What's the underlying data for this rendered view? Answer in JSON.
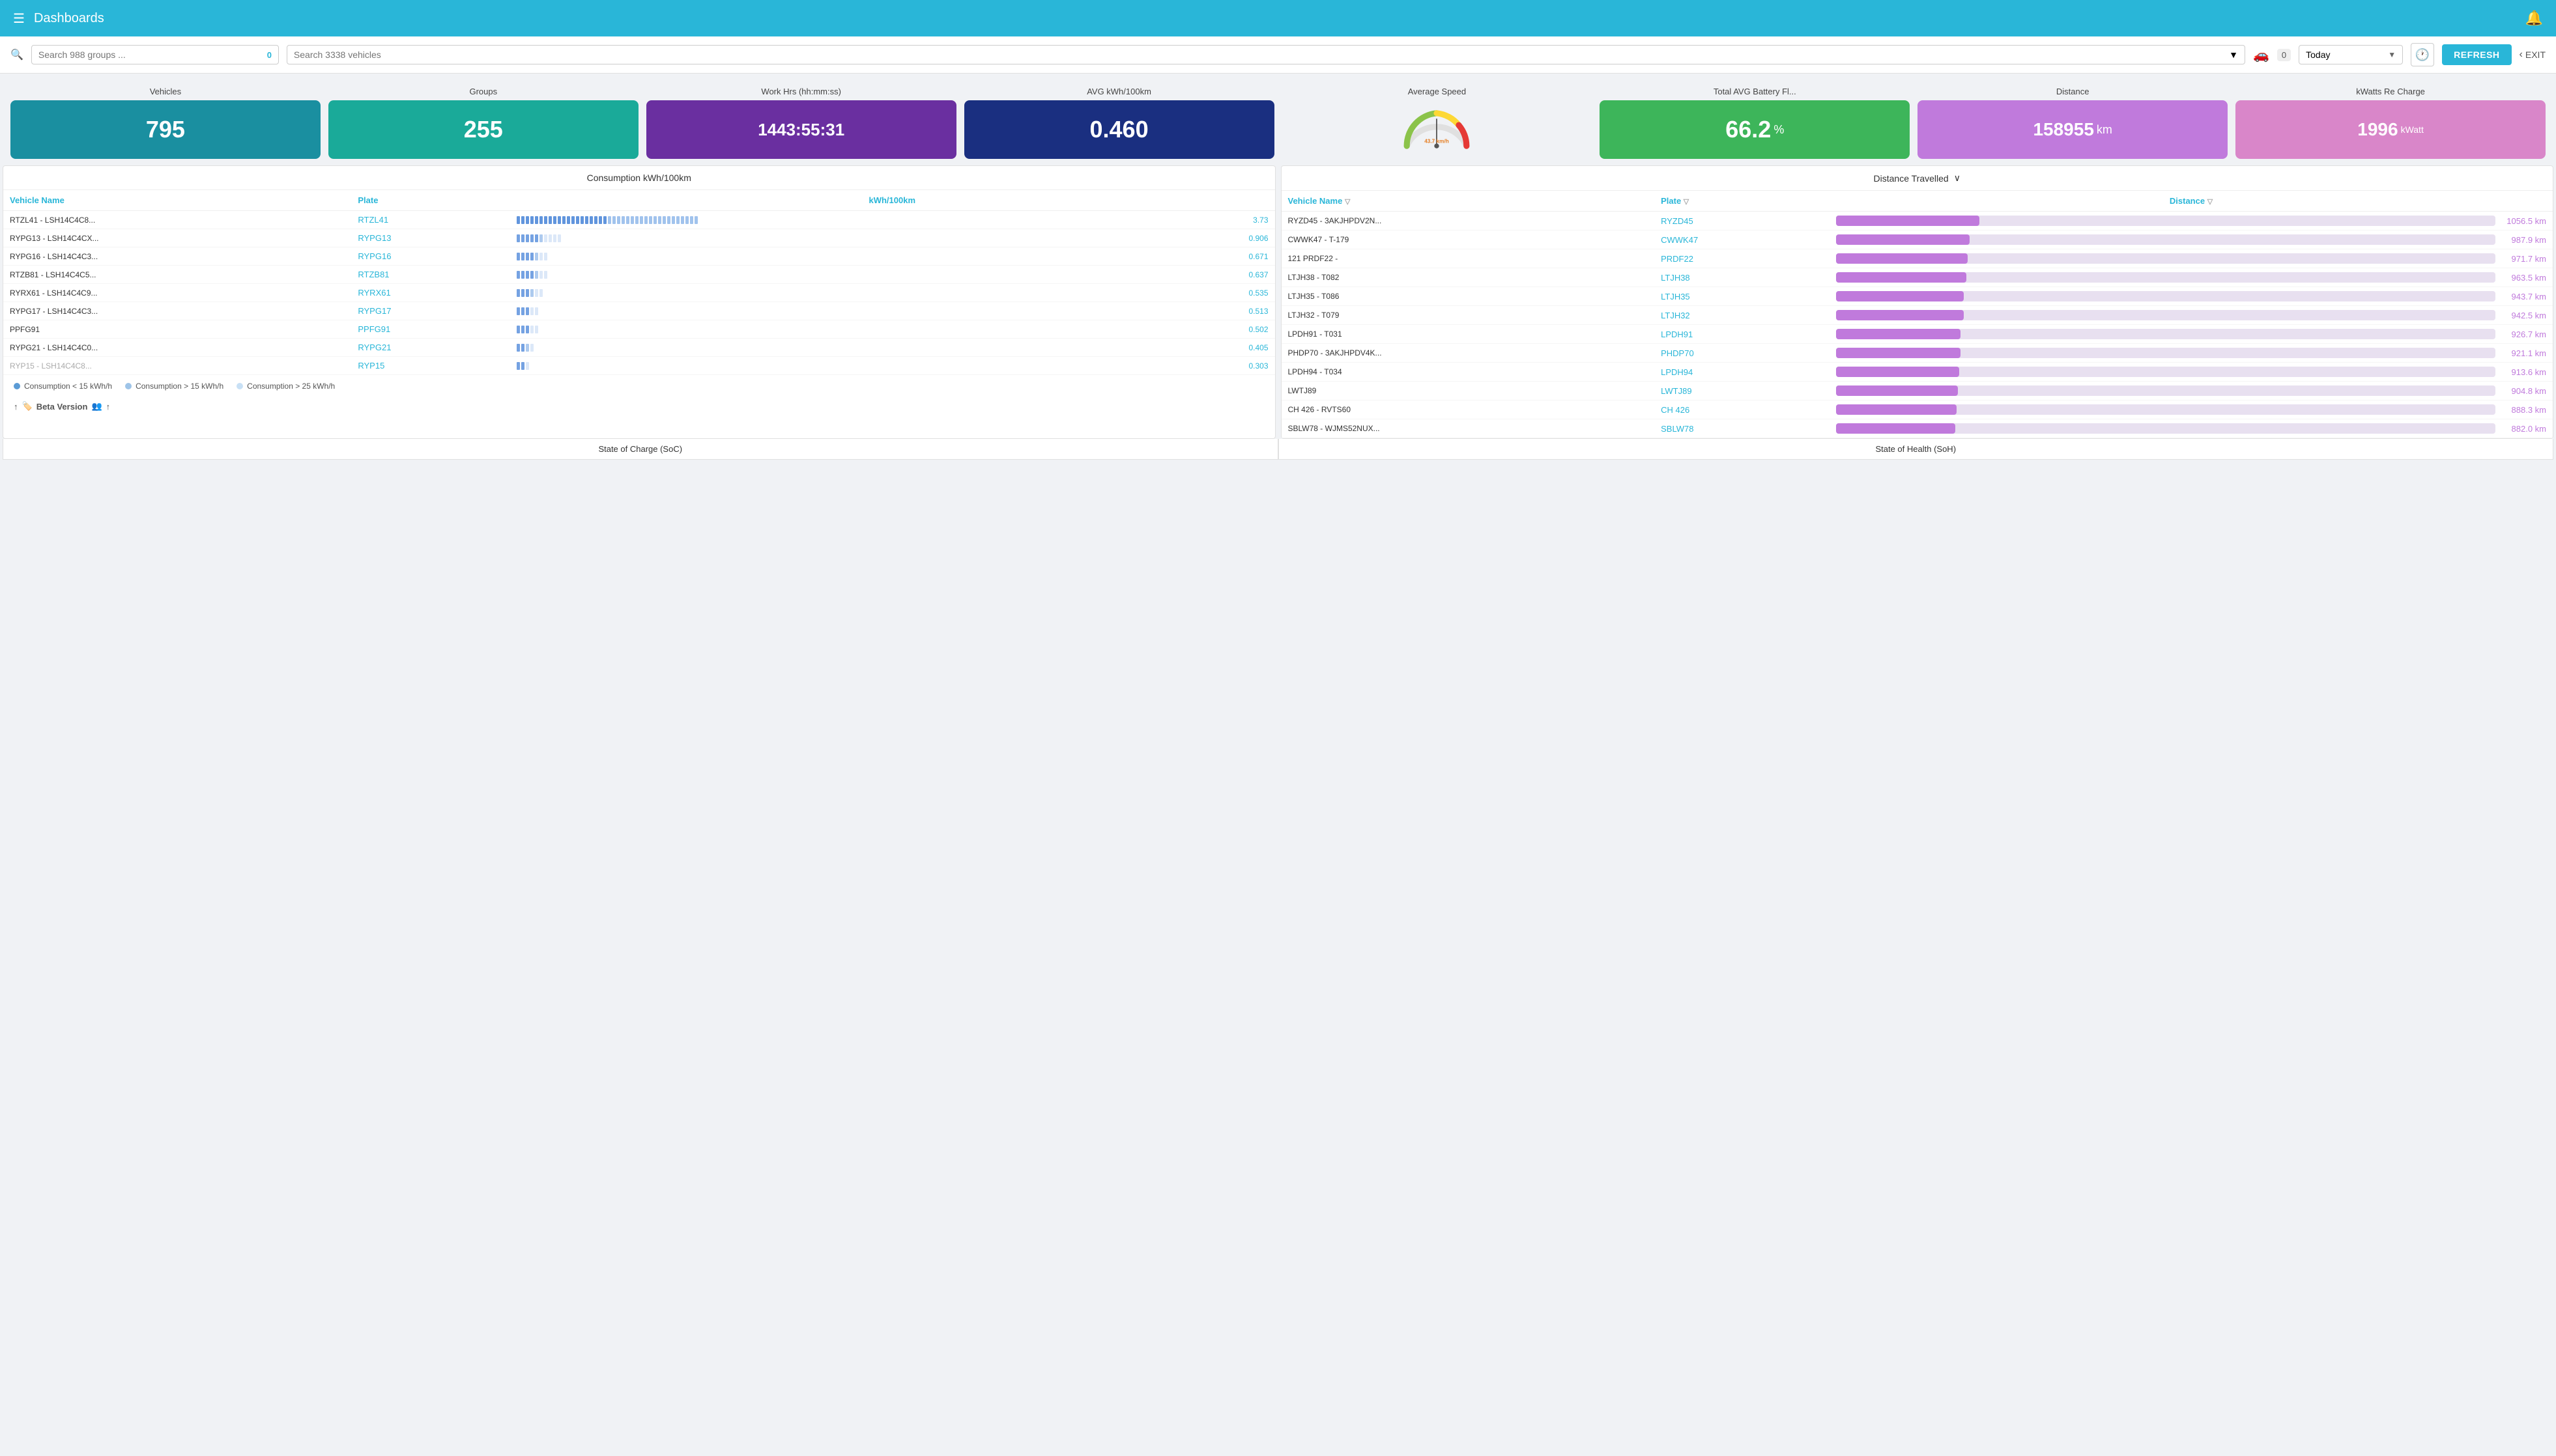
{
  "header": {
    "menu_icon": "☰",
    "title": "Dashboards",
    "bell_icon": "🔔"
  },
  "toolbar": {
    "search_groups_placeholder": "Search 988 groups ...",
    "search_groups_badge": "0",
    "search_vehicles_placeholder": "Search 3338 vehicles",
    "vehicle_icon": "🚗",
    "vehicle_count": "0",
    "date_label": "Today",
    "clock_icon": "🕐",
    "refresh_label": "REFRESH",
    "exit_label": "EXIT"
  },
  "stats": [
    {
      "label": "Vehicles",
      "value": "795",
      "suffix": "",
      "color": "teal"
    },
    {
      "label": "Groups",
      "value": "255",
      "suffix": "",
      "color": "teal2"
    },
    {
      "label": "Work Hrs (hh:mm:ss)",
      "value": "1443:55:31",
      "suffix": "",
      "color": "purple",
      "small": true
    },
    {
      "label": "AVG kWh/100km",
      "value": "0.460",
      "suffix": "",
      "color": "navy"
    },
    {
      "label": "Average Speed",
      "value": "43.7 km/h",
      "color": "gauge"
    },
    {
      "label": "Total AVG Battery Fl...",
      "value": "66.2",
      "suffix": "%",
      "color": "green"
    },
    {
      "label": "Distance",
      "value": "158955",
      "suffix": " km",
      "color": "violet"
    },
    {
      "label": "kWatts Re Charge",
      "value": "1996",
      "suffix": " kWatt",
      "color": "pink"
    }
  ],
  "consumption_table": {
    "title": "Consumption kWh/100km",
    "columns": [
      "Vehicle Name",
      "Plate",
      "kWh/100km"
    ],
    "rows": [
      {
        "name": "RTZL41 - LSH14C4C8...",
        "plate": "RTZL41",
        "value": 3.73,
        "bar_pct": 100
      },
      {
        "name": "RYPG13 - LSH14C4CX...",
        "plate": "RYPG13",
        "value": 0.906,
        "bar_pct": 24
      },
      {
        "name": "RYPG16 - LSH14C4C3...",
        "plate": "RYPG16",
        "value": 0.671,
        "bar_pct": 18
      },
      {
        "name": "RTZB81 - LSH14C4C5...",
        "plate": "RTZB81",
        "value": 0.637,
        "bar_pct": 17
      },
      {
        "name": "RYRX61 - LSH14C4C9...",
        "plate": "RYRX61",
        "value": 0.535,
        "bar_pct": 14
      },
      {
        "name": "RYPG17 - LSH14C4C3...",
        "plate": "RYPG17",
        "value": 0.513,
        "bar_pct": 13
      },
      {
        "name": "PPFG91",
        "plate": "PPFG91",
        "value": 0.502,
        "bar_pct": 13
      },
      {
        "name": "RYPG21 - LSH14C4C0...",
        "plate": "RYPG21",
        "value": 0.405,
        "bar_pct": 10
      },
      {
        "name": "RYP15 - LSH14C4C8...",
        "plate": "RYP15",
        "value": 0.303,
        "bar_pct": 8,
        "truncated": true
      }
    ],
    "legend": [
      {
        "label": "Consumption < 15 kWh/h",
        "color": "blue1"
      },
      {
        "label": "Consumption > 15 kWh/h",
        "color": "blue2"
      },
      {
        "label": "Consumption > 25 kWh/h",
        "color": "blue3"
      }
    ]
  },
  "distance_table": {
    "title": "Distance Travelled",
    "columns": [
      "Vehicle Name",
      "Plate",
      "Distance"
    ],
    "rows": [
      {
        "name": "RYZD45 - 3AKJHPDV2N...",
        "plate": "RYZD45",
        "value": "1056.5 km",
        "bar_pct": 100
      },
      {
        "name": "CWWK47 - T-179",
        "plate": "CWWK47",
        "value": "987.9 km",
        "bar_pct": 93
      },
      {
        "name": "121 PRDF22 -",
        "plate": "PRDF22",
        "value": "971.7 km",
        "bar_pct": 92
      },
      {
        "name": "LTJH38 - T082",
        "plate": "LTJH38",
        "value": "963.5 km",
        "bar_pct": 91
      },
      {
        "name": "LTJH35 - T086",
        "plate": "LTJH35",
        "value": "943.7 km",
        "bar_pct": 89
      },
      {
        "name": "LTJH32 - T079",
        "plate": "LTJH32",
        "value": "942.5 km",
        "bar_pct": 89
      },
      {
        "name": "LPDH91 - T031",
        "plate": "LPDH91",
        "value": "926.7 km",
        "bar_pct": 87
      },
      {
        "name": "PHDP70 - 3AKJHPDV4K...",
        "plate": "PHDP70",
        "value": "921.1 km",
        "bar_pct": 87
      },
      {
        "name": "LPDH94 - T034",
        "plate": "LPDH94",
        "value": "913.6 km",
        "bar_pct": 86
      },
      {
        "name": "LWTJ89",
        "plate": "LWTJ89",
        "value": "904.8 km",
        "bar_pct": 85
      },
      {
        "name": "CH 426 - RVTS60",
        "plate": "CH 426",
        "value": "888.3 km",
        "bar_pct": 84
      },
      {
        "name": "SBLW78 - WJMS52NUX...",
        "plate": "SBLW78",
        "value": "882.0 km",
        "bar_pct": 83
      }
    ]
  },
  "bottom_labels": {
    "left": "State of Charge (SoC)",
    "right": "State of Health (SoH)"
  },
  "beta_text": "Beta Version"
}
